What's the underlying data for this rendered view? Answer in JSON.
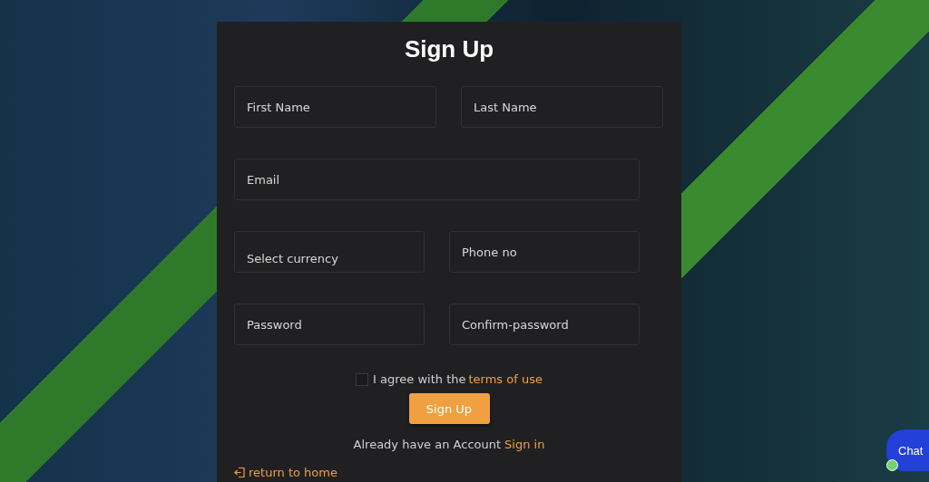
{
  "title": "Sign Up",
  "field_rows": [
    [
      {
        "kind": "input",
        "placeholder": "First Name"
      },
      {
        "kind": "input",
        "placeholder": "Last Name"
      }
    ],
    [
      {
        "kind": "input",
        "placeholder": "Email"
      }
    ],
    [
      {
        "kind": "select",
        "placeholder": "Select currency"
      },
      {
        "kind": "input",
        "placeholder": "Phone no"
      }
    ],
    [
      {
        "kind": "password",
        "placeholder": "Password"
      },
      {
        "kind": "password",
        "placeholder": "Confirm-password"
      }
    ]
  ],
  "agree": {
    "checked": false,
    "text": "I agree with the",
    "link": "terms of use"
  },
  "submit": "Sign Up",
  "signin": {
    "text": "Already have an Account",
    "link": "Sign in"
  },
  "return_link": "return to home",
  "chat": {
    "label": "Chat",
    "online": true
  }
}
